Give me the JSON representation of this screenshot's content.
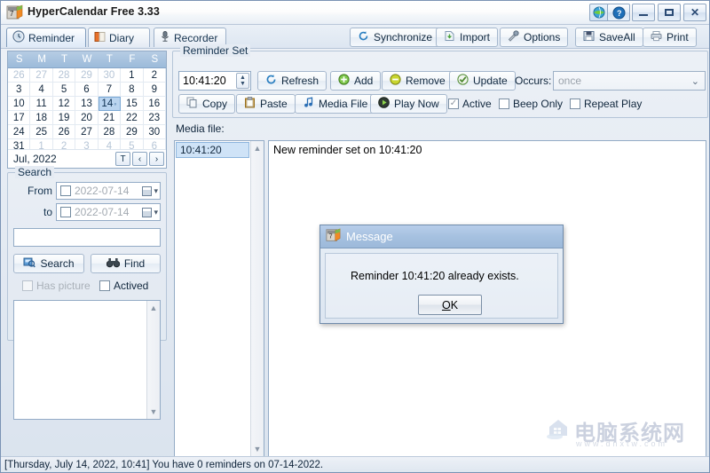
{
  "window": {
    "title": "HyperCalendar Free 3.33",
    "app_icon": "calendar-7-icon",
    "buttons": {
      "extra": "globe-icon",
      "help": "?",
      "minimize": "minimize-icon",
      "maximize": "maximize-icon",
      "close": "✕"
    }
  },
  "tabs": [
    {
      "label": "Reminder",
      "icon": "clock-icon",
      "active": true
    },
    {
      "label": "Diary",
      "icon": "book-icon",
      "active": false
    },
    {
      "label": "Recorder",
      "icon": "microphone-icon",
      "active": false
    }
  ],
  "toolbar": [
    {
      "label": "Synchronize",
      "icon": "sync-icon"
    },
    {
      "label": "Import",
      "icon": "import-icon"
    },
    {
      "label": "Options",
      "icon": "tools-icon"
    },
    {
      "label": "SaveAll",
      "icon": "save-icon"
    },
    {
      "label": "Print",
      "icon": "printer-icon"
    }
  ],
  "calendar": {
    "weekdays": [
      "S",
      "M",
      "T",
      "W",
      "T",
      "F",
      "S"
    ],
    "month_label": "Jul, 2022",
    "selected_day": 14,
    "nav": {
      "today": "T",
      "prev": "‹",
      "next": "›"
    },
    "weeks": [
      [
        {
          "d": "26",
          "o": true
        },
        {
          "d": "27",
          "o": true
        },
        {
          "d": "28",
          "o": true
        },
        {
          "d": "29",
          "o": true
        },
        {
          "d": "30",
          "o": true
        },
        {
          "d": "1",
          "o": false
        },
        {
          "d": "2",
          "o": false
        }
      ],
      [
        {
          "d": "3",
          "o": false
        },
        {
          "d": "4",
          "o": false
        },
        {
          "d": "5",
          "o": false
        },
        {
          "d": "6",
          "o": false
        },
        {
          "d": "7",
          "o": false
        },
        {
          "d": "8",
          "o": false
        },
        {
          "d": "9",
          "o": false
        }
      ],
      [
        {
          "d": "10",
          "o": false
        },
        {
          "d": "11",
          "o": false
        },
        {
          "d": "12",
          "o": false
        },
        {
          "d": "13",
          "o": false
        },
        {
          "d": "14",
          "o": false,
          "sel": true
        },
        {
          "d": "15",
          "o": false
        },
        {
          "d": "16",
          "o": false
        }
      ],
      [
        {
          "d": "17",
          "o": false
        },
        {
          "d": "18",
          "o": false
        },
        {
          "d": "19",
          "o": false
        },
        {
          "d": "20",
          "o": false
        },
        {
          "d": "21",
          "o": false
        },
        {
          "d": "22",
          "o": false
        },
        {
          "d": "23",
          "o": false
        }
      ],
      [
        {
          "d": "24",
          "o": false
        },
        {
          "d": "25",
          "o": false
        },
        {
          "d": "26",
          "o": false
        },
        {
          "d": "27",
          "o": false
        },
        {
          "d": "28",
          "o": false
        },
        {
          "d": "29",
          "o": false
        },
        {
          "d": "30",
          "o": false
        }
      ],
      [
        {
          "d": "31",
          "o": false
        },
        {
          "d": "1",
          "o": true
        },
        {
          "d": "2",
          "o": true
        },
        {
          "d": "3",
          "o": true
        },
        {
          "d": "4",
          "o": true
        },
        {
          "d": "5",
          "o": true
        },
        {
          "d": "6",
          "o": true
        }
      ]
    ]
  },
  "search": {
    "group_title": "Search",
    "from_label": "From",
    "from_value": "2022-07-14",
    "to_label": "to",
    "to_value": "2022-07-14",
    "query_value": "",
    "query_placeholder": "",
    "search_button": "Search",
    "find_button": "Find",
    "has_picture_label": "Has picture",
    "actived_label": "Actived"
  },
  "reminder_set": {
    "group_title": "Reminder Set",
    "time_value": "10:41:20",
    "refresh_label": "Refresh",
    "add_label": "Add",
    "remove_label": "Remove",
    "update_label": "Update",
    "occurs_label": "Occurs:",
    "occurs_value": "once",
    "copy_label": "Copy",
    "paste_label": "Paste",
    "media_file_label": "Media File",
    "play_now_label": "Play Now",
    "active_label": "Active",
    "beep_only_label": "Beep Only",
    "repeat_play_label": "Repeat Play",
    "media_file_field_label": "Media file:",
    "media_file_value": ""
  },
  "reminders": {
    "items": [
      "10:41:20"
    ],
    "selected_index": 0,
    "content": "New reminder set on 10:41:20"
  },
  "dialog": {
    "title": "Message",
    "icon": "calendar-7-icon",
    "message": "Reminder 10:41:20 already exists.",
    "ok_label": "OK",
    "ok_accel": "O",
    "ok_rest": "K"
  },
  "statusbar": {
    "text": "[Thursday, July 14, 2022, 10:41] You have 0 reminders on 07-14-2022."
  },
  "watermark": {
    "main": "电脑系统网",
    "sub": "www.dnxtw.com"
  },
  "colors": {
    "accent": "#9cbbda",
    "selection": "#cfe3f7",
    "window_bg": "#e5ebf3",
    "titlebar": "#ffffff"
  }
}
